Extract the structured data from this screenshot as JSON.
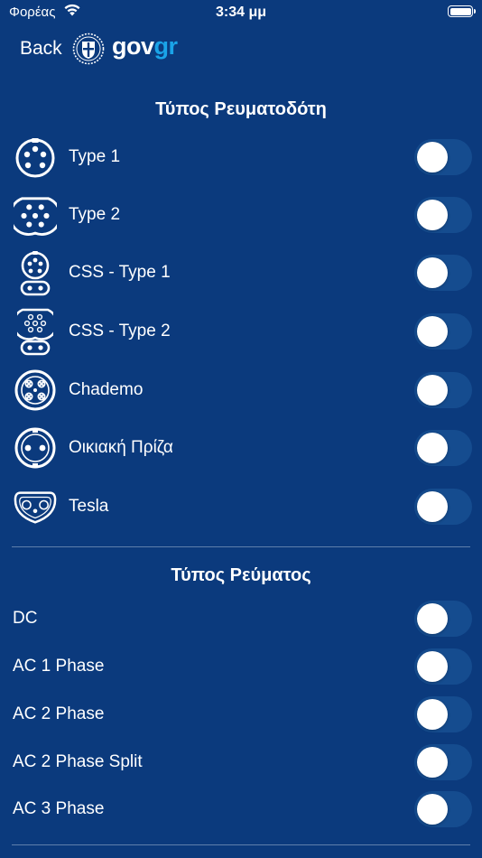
{
  "status": {
    "carrier": "Φορέας",
    "time": "3:34 μμ"
  },
  "nav": {
    "back_label": "Back",
    "logo_gov": "gov",
    "logo_gr": "gr"
  },
  "connector_section": {
    "title": "Τύπος Ρευματοδότη",
    "items": [
      {
        "label": "Type 1",
        "icon": "type1-connector-icon",
        "enabled": false
      },
      {
        "label": "Type 2",
        "icon": "type2-connector-icon",
        "enabled": false
      },
      {
        "label": "CSS - Type 1",
        "icon": "ccs-type1-connector-icon",
        "enabled": false
      },
      {
        "label": "CSS - Type 2",
        "icon": "ccs-type2-connector-icon",
        "enabled": false
      },
      {
        "label": "Chademo",
        "icon": "chademo-connector-icon",
        "enabled": false
      },
      {
        "label": "Οικιακή Πρίζα",
        "icon": "household-socket-icon",
        "enabled": false
      },
      {
        "label": "Tesla",
        "icon": "tesla-connector-icon",
        "enabled": false
      }
    ]
  },
  "current_section": {
    "title": "Τύπος Ρεύματος",
    "items": [
      {
        "label": "DC",
        "enabled": false
      },
      {
        "label": "AC 1 Phase",
        "enabled": false
      },
      {
        "label": "AC 2 Phase",
        "enabled": false
      },
      {
        "label": "AC 2 Phase Split",
        "enabled": false
      },
      {
        "label": "AC 3 Phase",
        "enabled": false
      }
    ]
  },
  "colors": {
    "background": "#0b3a7d",
    "toggle_off": "#154c8f",
    "accent": "#1aa3e8"
  }
}
